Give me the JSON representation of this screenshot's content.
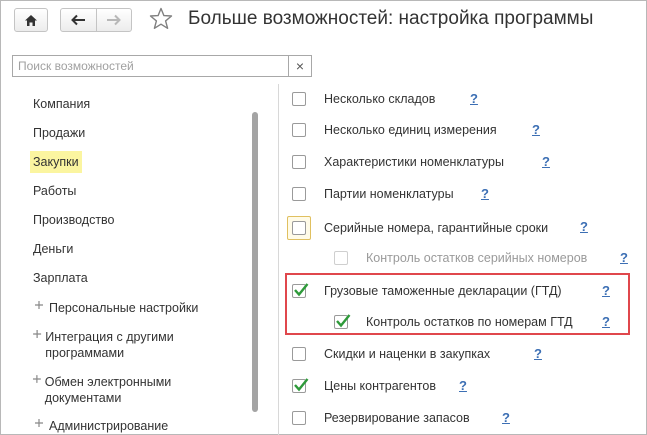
{
  "header": {
    "title": "Больше возможностей: настройка программы"
  },
  "search": {
    "placeholder": "Поиск возможностей",
    "clear_symbol": "×"
  },
  "sidebar": {
    "items": [
      {
        "label": "Компания"
      },
      {
        "label": "Продажи"
      },
      {
        "label": "Закупки"
      },
      {
        "label": "Работы"
      },
      {
        "label": "Производство"
      },
      {
        "label": "Деньги"
      },
      {
        "label": "Зарплата"
      }
    ],
    "groups": [
      {
        "label": "Персональные настройки"
      },
      {
        "label": "Интеграция с другими программами"
      },
      {
        "label": "Обмен электронными документами"
      },
      {
        "label": "Администрирование"
      }
    ],
    "active": "Закупки"
  },
  "options": [
    {
      "label": "Несколько складов",
      "checked": false,
      "help": "?"
    },
    {
      "label": "Несколько единиц измерения",
      "checked": false,
      "help": "?"
    },
    {
      "label": "Характеристики номенклатуры",
      "checked": false,
      "help": "?"
    },
    {
      "label": "Партии номенклатуры",
      "checked": false,
      "help": "?"
    },
    {
      "label": "Серийные номера, гарантийные сроки",
      "checked": false,
      "help": "?"
    },
    {
      "label": "Контроль остатков серийных номеров",
      "checked": false,
      "disabled": true,
      "help": "?"
    },
    {
      "label": "Грузовые таможенные декларации (ГТД)",
      "checked": true,
      "help": "?"
    },
    {
      "label": "Контроль остатков по номерам ГТД",
      "checked": true,
      "help": "?"
    },
    {
      "label": "Скидки и наценки в закупках",
      "checked": false,
      "help": "?"
    },
    {
      "label": "Цены контрагентов",
      "checked": true,
      "help": "?"
    },
    {
      "label": "Резервирование запасов",
      "checked": false,
      "help": "?"
    }
  ],
  "colors": {
    "check": "#2e9a3a",
    "highlight": "#e0474c",
    "active_item": "#fbf5a0",
    "help_link": "#3c6fb4"
  }
}
